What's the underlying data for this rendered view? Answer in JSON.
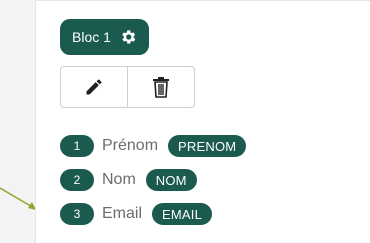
{
  "colors": {
    "accent": "#1a5a4f",
    "arrow": "#8aa829"
  },
  "bloc": {
    "label": "Bloc 1",
    "icon": "gear-icon"
  },
  "actions": {
    "edit_icon": "pencil-icon",
    "delete_icon": "trash-icon"
  },
  "fields": [
    {
      "number": "1",
      "label": "Prénom",
      "tag": "PRENOM"
    },
    {
      "number": "2",
      "label": "Nom",
      "tag": "NOM"
    },
    {
      "number": "3",
      "label": "Email",
      "tag": "EMAIL"
    }
  ]
}
